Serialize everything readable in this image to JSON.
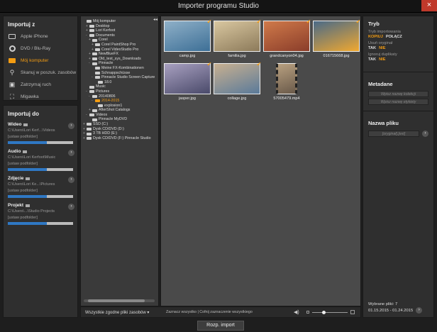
{
  "window": {
    "title": "Importer programu Studio",
    "close": "×"
  },
  "import_from": {
    "title": "Importuj z",
    "items": [
      {
        "label": "Apple iPhone",
        "icon": "camera-icon"
      },
      {
        "label": "DVD / Blu-Ray",
        "icon": "disc-icon"
      },
      {
        "label": "Mój komputer",
        "icon": "folder-icon"
      },
      {
        "label": "Skanuj w poszuk. zasobów",
        "icon": "search-icon"
      },
      {
        "label": "Zatrzymaj ruch",
        "icon": "stop-motion-icon"
      },
      {
        "label": "Migawka",
        "icon": "snapshot-icon"
      }
    ]
  },
  "import_to": {
    "title": "Importuj do",
    "dests": [
      {
        "label": "Wideo",
        "path": "C:\\Users\\Lori Kerf...\\Videos",
        "sub": "[ustaw podfolder]",
        "used": 0.6
      },
      {
        "label": "Audio",
        "path": "C:\\Users\\Lori Kerfoot\\Music",
        "sub": "[ustaw podfolder]",
        "used": 0.6
      },
      {
        "label": "Zdjęcie",
        "path": "C:\\Users\\Lori Ke...\\Pictures",
        "sub": "[ustaw podfolder]",
        "used": 0.6
      },
      {
        "label": "Projekt",
        "path": "C:\\Users\\...\\Studio Projects",
        "sub": "[ustaw podfolder]",
        "used": 0.6
      }
    ]
  },
  "tree": [
    "Mój komputer",
    "Desktop",
    "Lori Kerfoot",
    "Documents",
    "Corel",
    "Corel PaintShop Pro",
    "Corel VideoStudio Pro",
    "NewBlueFX",
    "Old_test_sys_Downloads",
    "Pinnacle",
    "Meine FX-Kombinationen",
    "Schnappschüsse",
    "Pinnacle Studio Screen Capture",
    "18.0",
    "Music",
    "Pictures",
    "20140806",
    "2014-2015",
    "explosion1",
    "AfterShot Catalogs",
    "Videos",
    "Pinnacle MyDVD",
    "SSD (C:)",
    "Dysk CD/DVD (D:)",
    "3 TB HDD (E:)",
    "Dysk CD/DVD (F:) Pinnacle Studio"
  ],
  "files": [
    {
      "name": "camp.jpg",
      "colors": [
        "#3d6f96",
        "#8fb0c8"
      ],
      "checked": true
    },
    {
      "name": "familia.jpg",
      "colors": [
        "#8c7a5a",
        "#d9c7a0"
      ],
      "checked": true
    },
    {
      "name": "grandcanyon04.jpg",
      "colors": [
        "#8a3d2a",
        "#d07a4a"
      ],
      "checked": true
    },
    {
      "name": "016715668.jpg",
      "colors": [
        "#f0a830",
        "#4a6a88"
      ],
      "checked": true
    },
    {
      "name": "jasper.jpg",
      "colors": [
        "#4a4a6a",
        "#a8a0c0"
      ],
      "checked": true
    },
    {
      "name": "collage.jpg",
      "colors": [
        "#5a7a9a",
        "#c8b090"
      ],
      "checked": true
    },
    {
      "name": "57005479.mp4",
      "colors": [
        "#6a5a4a",
        "#b8a080"
      ],
      "checked": false
    }
  ],
  "bottom": {
    "filter": "Wszystkie zgodne pliki zasobów ▾",
    "select": "Zaznacz wszystko | Cofnij zaznaczenie wszystkiego"
  },
  "mode": {
    "title": "Tryb",
    "import_mode": "Tryb importowania",
    "copy": "KOPIUJ",
    "link": "POŁĄCZ",
    "remove_orig": "Usuń oryginał",
    "yes": "TAK",
    "no": "NIE",
    "ignore_dupes": "Ignoruj duplikaty"
  },
  "metadata": {
    "title": "Metadane",
    "collection": "Wpisz nazwę kolekcji",
    "tags": "Wpisz nazwę etykiety"
  },
  "filename": {
    "title": "Nazwa pliku",
    "value": "[oryginał].[ext]"
  },
  "summary": {
    "count": "Wybrane pliki: 7",
    "dates": "01.15.2015 - 01.24.2015"
  },
  "import_button": "Rozp. import"
}
